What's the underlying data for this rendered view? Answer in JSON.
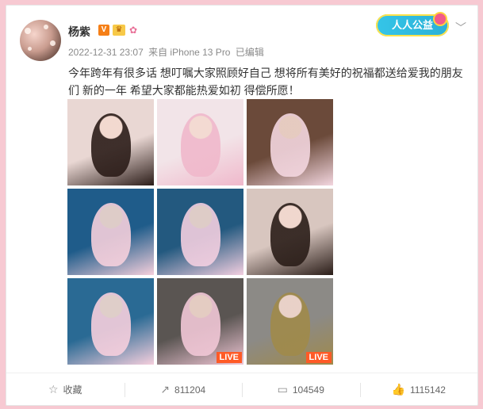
{
  "post": {
    "author": "杨紫",
    "date": "2022-12-31 23:07",
    "source": "来自 iPhone 13 Pro",
    "edited": "已编辑",
    "text": "今年跨年有很多话 想叮嘱大家照顾好自己 想将所有美好的祝福都送给爱我的朋友们 新的一年 希望大家都能热爱如初 得偿所愿！",
    "badge_v": "V",
    "badge_crown": "♛",
    "badge_pig": "✿",
    "charity_label": "人人公益",
    "more_icon": "﹀"
  },
  "photos": [
    {
      "label": "",
      "live": "",
      "bg": "#e9d7d3",
      "accent": "#2b1c18"
    },
    {
      "label": "",
      "live": "",
      "bg": "#f2e4e8",
      "accent": "#f0b8cb"
    },
    {
      "label": "",
      "live": "",
      "bg": "#6b4a3a",
      "accent": "#f3d6df"
    },
    {
      "label": "",
      "live": "",
      "bg": "#1f5c8a",
      "accent": "#f6d0dc"
    },
    {
      "label": "",
      "live": "",
      "bg": "#23597f",
      "accent": "#f3cfe0"
    },
    {
      "label": "",
      "live": "",
      "bg": "#d8c6bf",
      "accent": "#2a1d18"
    },
    {
      "label": "",
      "live": "",
      "bg": "#2a6a94",
      "accent": "#f6cfdd"
    },
    {
      "label": "",
      "live": "LIVE",
      "bg": "#5a5552",
      "accent": "#f1c7d6"
    },
    {
      "label": "",
      "live": "LIVE",
      "bg": "#8c8a86",
      "accent": "#a08a4a"
    }
  ],
  "actions": {
    "favorite": {
      "icon": "☆",
      "label": "收藏"
    },
    "repost": {
      "icon": "↗",
      "count": "811204"
    },
    "comment": {
      "icon": "▭",
      "count": "104549"
    },
    "like": {
      "icon": "👍",
      "count": "1115142"
    }
  },
  "colors": {
    "page_bg": "#f7c9d2",
    "live_badge": "#ff5a26",
    "verified": "#f57f17"
  }
}
